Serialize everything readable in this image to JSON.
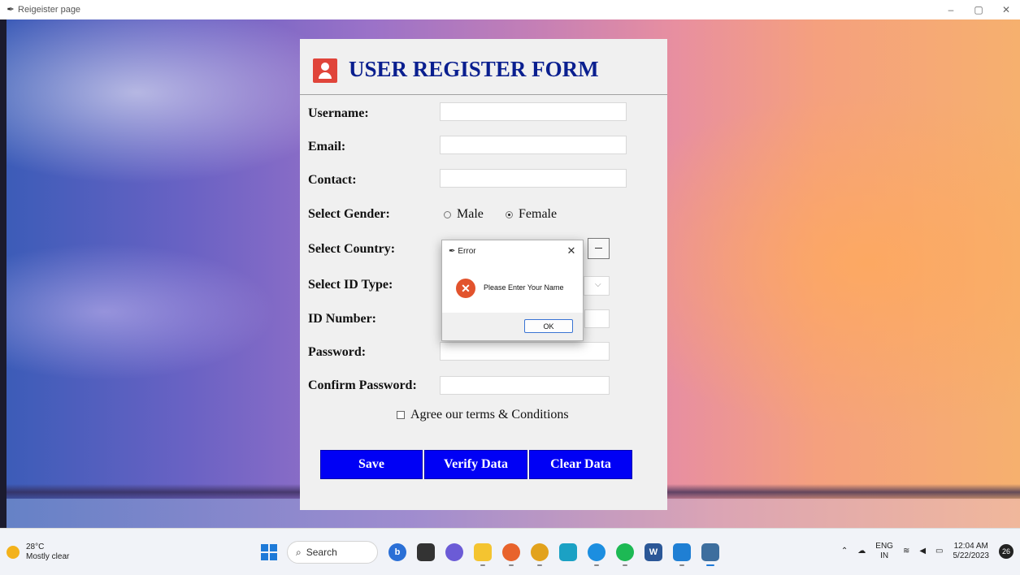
{
  "window": {
    "title": "Reigeister page",
    "minimize": "–",
    "maximize": "▢",
    "close": "✕"
  },
  "form": {
    "heading": "USER REGISTER FORM",
    "fields": {
      "username_label": "Username:",
      "username_value": "",
      "email_label": "Email:",
      "email_value": "",
      "contact_label": "Contact:",
      "contact_value": "",
      "gender_label": "Select Gender:",
      "gender_options": [
        "Male",
        "Female"
      ],
      "country_label": "Select Country:",
      "id_type_label": "Select ID Type:",
      "id_number_label": "ID Number:",
      "password_label": "Password:",
      "confirm_password_label": "Confirm Password:"
    },
    "terms_label": "Agree our terms & Conditions",
    "buttons": {
      "save": "Save",
      "verify": "Verify Data",
      "clear": "Clear Data"
    },
    "button_color": "#0000f5",
    "heading_color": "#0a1f8f"
  },
  "dialog": {
    "title": "Error",
    "message": "Please Enter Your Name",
    "ok_label": "OK",
    "close_glyph": "✕"
  },
  "taskbar": {
    "weather_temp": "28°C",
    "weather_desc": "Mostly clear",
    "search_label": "Search",
    "lang_top": "ENG",
    "lang_bottom": "IN",
    "time": "12:04 AM",
    "date": "5/22/2023",
    "notification_count": "26"
  },
  "icons": [
    "feather-icon",
    "user-icon",
    "error-icon",
    "search-icon",
    "windows-icon",
    "wifi-icon",
    "volume-icon",
    "battery-icon"
  ]
}
